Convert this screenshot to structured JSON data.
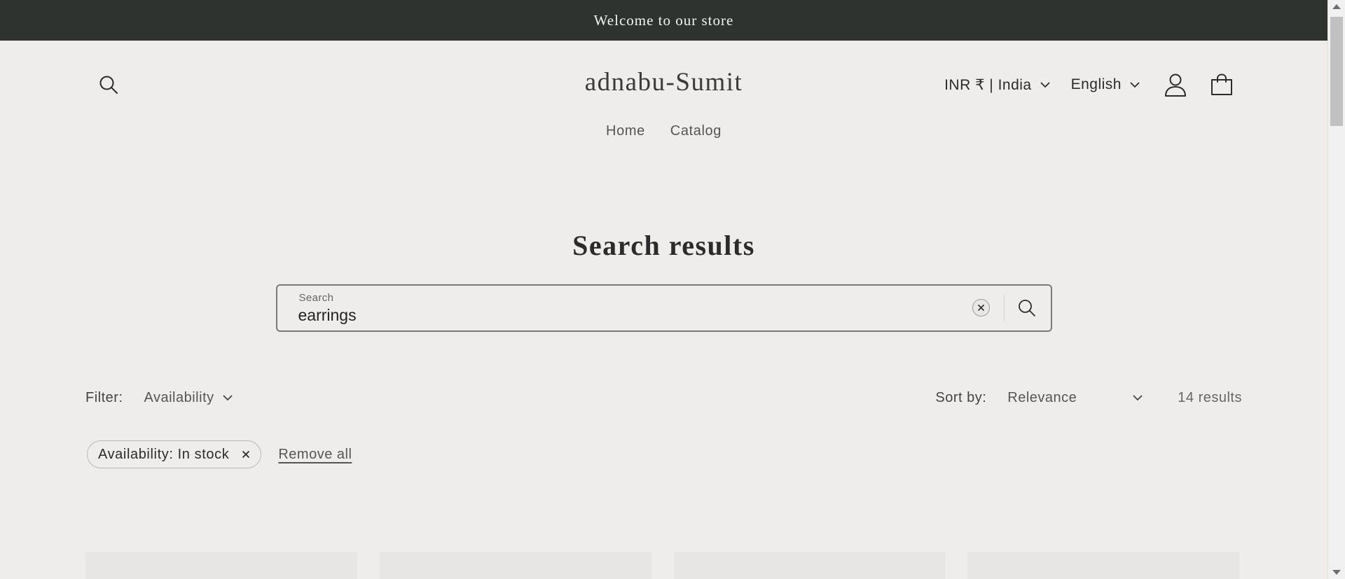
{
  "announcement": {
    "text": "Welcome to our store"
  },
  "header": {
    "logo": "adnabu-Sumit",
    "currency_selector": "INR ₹ | India",
    "language_selector": "English",
    "icons": [
      "search-icon",
      "account-icon",
      "cart-icon"
    ]
  },
  "nav": {
    "items": [
      {
        "label": "Home"
      },
      {
        "label": "Catalog"
      }
    ]
  },
  "main": {
    "title": "Search results",
    "search": {
      "label": "Search",
      "value": "earrings"
    },
    "filter": {
      "label": "Filter:",
      "availability": "Availability"
    },
    "sort": {
      "label": "Sort by:",
      "selected": "Relevance"
    },
    "result_count": "14 results",
    "active_facets": [
      {
        "label": "Availability: In stock"
      }
    ],
    "remove_all": "Remove all"
  },
  "colors": {
    "announcement_bg": "#2e332f",
    "page_bg": "#eeedeb",
    "text": "#2b2b2b"
  }
}
